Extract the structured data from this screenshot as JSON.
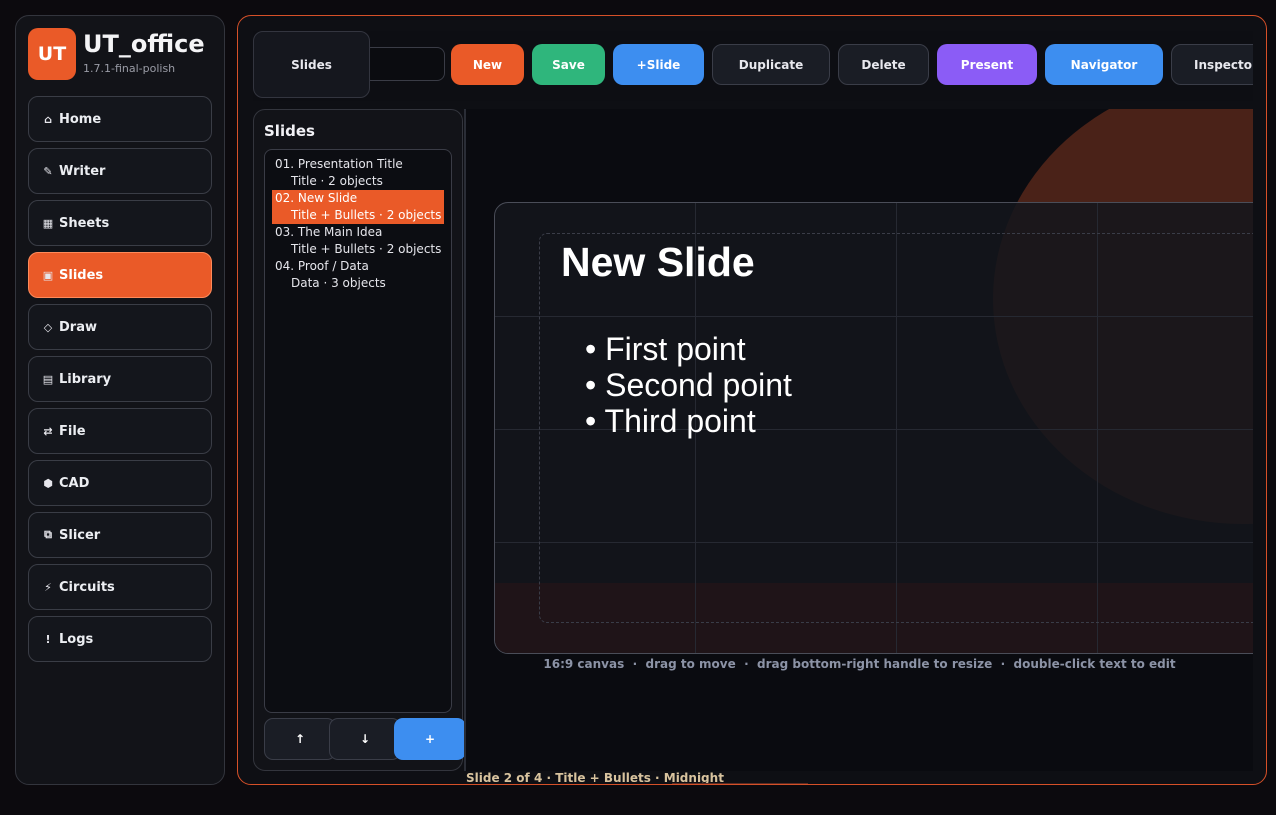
{
  "app": {
    "name": "UT_office",
    "logo_text": "UT",
    "version": "1.7.1-final-polish"
  },
  "sidebar": {
    "items": [
      {
        "icon": "⌂",
        "label": "Home",
        "active": false
      },
      {
        "icon": "✎",
        "label": "Writer",
        "active": false
      },
      {
        "icon": "▦",
        "label": "Sheets",
        "active": false
      },
      {
        "icon": "▣",
        "label": "Slides",
        "active": true
      },
      {
        "icon": "◇",
        "label": "Draw",
        "active": false
      },
      {
        "icon": "▤",
        "label": "Library",
        "active": false
      },
      {
        "icon": "⇄",
        "label": "File",
        "active": false
      },
      {
        "icon": "⬢",
        "label": "CAD",
        "active": false
      },
      {
        "icon": "⧉",
        "label": "Slicer",
        "active": false
      },
      {
        "icon": "⚡",
        "label": "Circuits",
        "active": false
      },
      {
        "icon": "!",
        "label": "Logs",
        "active": false
      }
    ]
  },
  "toolbar": {
    "section_label": "Slides",
    "input_value": "",
    "buttons": [
      "New",
      "Save",
      "+Slide",
      "Duplicate",
      "Delete",
      "Present",
      "Navigator",
      "Inspector"
    ]
  },
  "slides_panel": {
    "title": "Slides",
    "items": [
      {
        "title": "01. Presentation Title",
        "meta": "Title · 2 objects"
      },
      {
        "title": "02. New Slide",
        "meta": "Title + Bullets · 2 objects"
      },
      {
        "title": "03. The Main Idea",
        "meta": "Title + Bullets · 2 objects"
      },
      {
        "title": "04. Proof / Data",
        "meta": "Data · 3 objects"
      }
    ],
    "selected_index": 1,
    "buttons": {
      "up": "↑",
      "down": "↓",
      "add": "+"
    }
  },
  "slide": {
    "title": "New Slide",
    "bullets": [
      "• First point",
      "• Second point",
      "• Third point"
    ]
  },
  "hint": "16:9 canvas  ·  drag to move  ·  drag bottom-right handle to resize  ·  double-click text to edit",
  "status": "Slide 2 of 4 · Title + Bullets · Midnight",
  "colors": {
    "accent": "#ea5a28",
    "save": "#2fb67c",
    "blue": "#3d8ef0",
    "present": "#8b5cf6"
  }
}
